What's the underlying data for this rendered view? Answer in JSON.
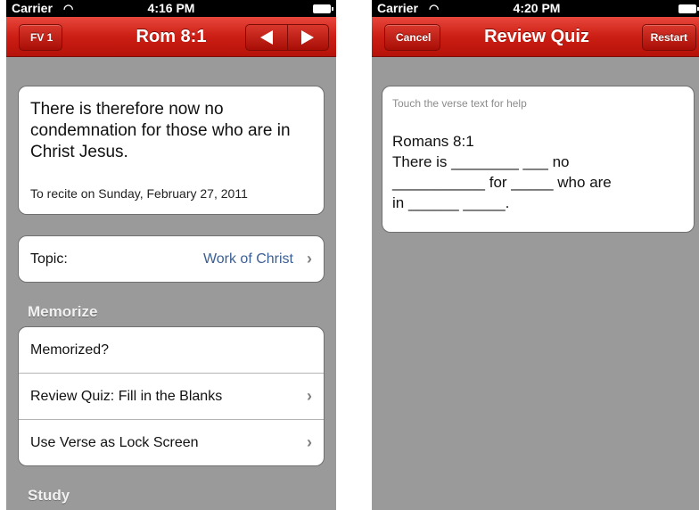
{
  "left_screen": {
    "status": {
      "carrier": "Carrier",
      "wifi_icon": "wifi-icon",
      "time": "4:16 PM",
      "battery_icon": "battery-icon"
    },
    "navbar": {
      "back_label": "FV 1",
      "title": "Rom 8:1",
      "prev_icon": "left-arrow-icon",
      "next_icon": "right-arrow-icon"
    },
    "verse_card": {
      "text": "There is therefore now no condemnation for those who are in Christ Jesus.",
      "recite_date": "To recite on Sunday, February 27, 2011"
    },
    "topic": {
      "label": "Topic:",
      "value": "Work of Christ"
    },
    "memorize": {
      "header": "Memorize",
      "items": [
        {
          "label": "Memorized?"
        },
        {
          "label": "Review Quiz: Fill in the Blanks"
        },
        {
          "label": "Use Verse as Lock Screen"
        }
      ]
    },
    "study": {
      "header": "Study"
    }
  },
  "right_screen": {
    "status": {
      "carrier": "Carrier",
      "wifi_icon": "wifi-icon",
      "time": "4:20 PM",
      "battery_icon": "battery-icon"
    },
    "navbar": {
      "cancel_label": "Cancel",
      "title": "Review Quiz",
      "restart_label": "Restart"
    },
    "quiz": {
      "hint": "Touch the verse text for help",
      "body": "Romans 8:1\nThere is ________ ___ no\n___________ for _____ who are\nin ______ _____."
    }
  }
}
